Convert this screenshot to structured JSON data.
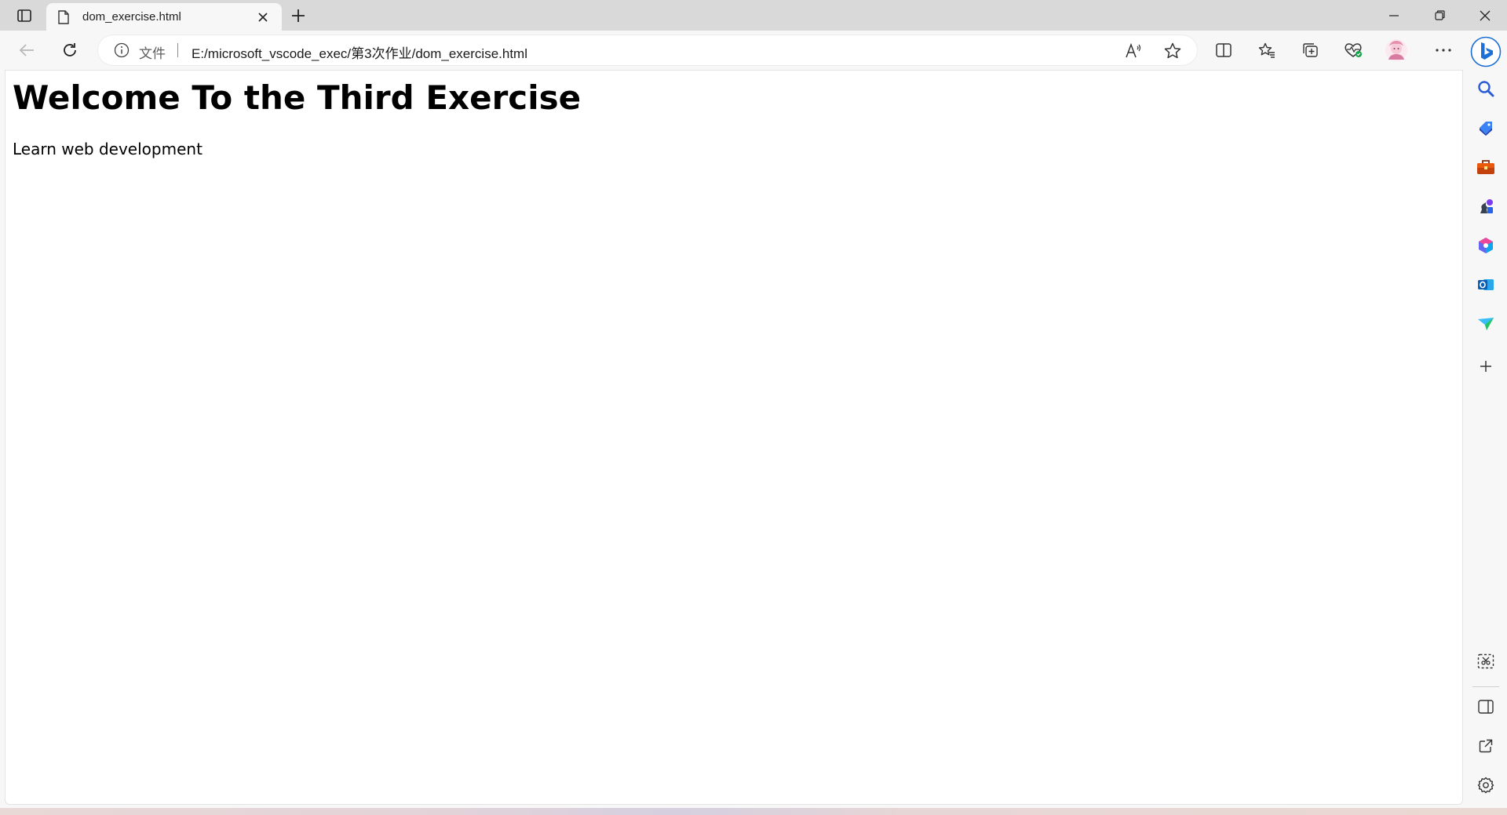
{
  "tab": {
    "title": "dom_exercise.html"
  },
  "addressbar": {
    "scheme_label": "文件",
    "url": "E:/microsoft_vscode_exec/第3次作业/dom_exercise.html"
  },
  "page": {
    "heading": "Welcome To the Third Exercise",
    "paragraph": "Learn web development"
  },
  "toolbar": {
    "icons": [
      "back-icon",
      "refresh-icon",
      "read-aloud-icon",
      "favorite-star-icon",
      "split-screen-icon",
      "favorites-icon",
      "collections-icon",
      "browser-essentials-icon",
      "profile-avatar",
      "more-icon",
      "copilot-icon"
    ]
  },
  "sidebar": {
    "icons": [
      "search-icon",
      "shopping-icon",
      "tools-icon",
      "games-icon",
      "microsoft365-icon",
      "outlook-icon",
      "send-icon",
      "add-icon",
      "screenshot-icon",
      "sidebar-panel-icon",
      "open-external-icon",
      "settings-icon"
    ]
  },
  "colors": {
    "tabstrip_bg": "#d9d9d9",
    "toolbar_bg": "#f7f7f7",
    "page_bg": "#ffffff",
    "copilot_blue": "#1b6fd6"
  }
}
